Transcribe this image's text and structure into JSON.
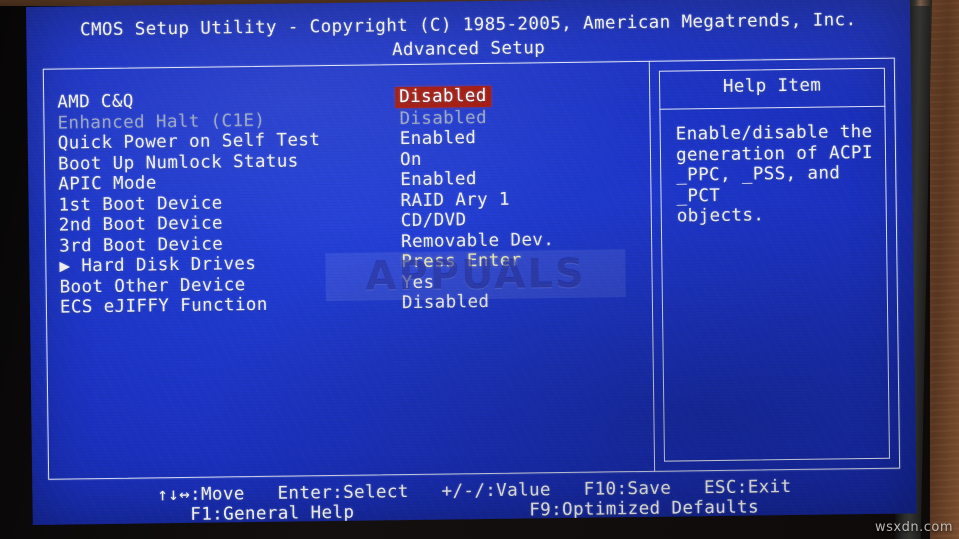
{
  "header": {
    "title": "CMOS Setup Utility - Copyright (C) 1985-2005, American Megatrends, Inc.",
    "subtitle": "Advanced Setup"
  },
  "settings": {
    "rows": [
      {
        "label": "AMD C&Q",
        "value": "Disabled",
        "state": "selected"
      },
      {
        "label": "Enhanced Halt (C1E)",
        "value": "Disabled",
        "state": "dimmed"
      },
      {
        "label": "Quick Power on Self Test",
        "value": "Enabled",
        "state": "normal"
      },
      {
        "label": "Boot Up Numlock Status",
        "value": "On",
        "state": "normal"
      },
      {
        "label": "APIC Mode",
        "value": "Enabled",
        "state": "normal"
      },
      {
        "label": "1st Boot Device",
        "value": "RAID Ary 1",
        "state": "normal"
      },
      {
        "label": "2nd Boot Device",
        "value": "CD/DVD",
        "state": "normal"
      },
      {
        "label": "3rd Boot Device",
        "value": "Removable Dev.",
        "state": "normal"
      },
      {
        "label": "Hard Disk Drives",
        "value": "Press Enter",
        "state": "submenu",
        "marker": "▶"
      },
      {
        "label": "Boot Other Device",
        "value": "Yes",
        "state": "normal"
      },
      {
        "label": "ECS eJIFFY Function",
        "value": "Disabled",
        "state": "normal"
      }
    ]
  },
  "help": {
    "title": "Help Item",
    "body": "Enable/disable the\ngeneration of ACPI\n_PPC, _PSS, and _PCT\nobjects."
  },
  "footer": {
    "line1": "↑↓↔:Move   Enter:Select   +/-/:Value   F10:Save   ESC:Exit",
    "line2": "F1:General Help                F9:Optimized Defaults"
  },
  "watermarks": {
    "center": "APPUALS",
    "corner": "wsxdn.com"
  },
  "colors": {
    "screen_blue": "#1c33c4",
    "selection_red": "#a4170c",
    "text_white": "#f2f2f2",
    "text_dimmed": "#9aa6c4",
    "text_yellow": "#f2efb4",
    "bezel_dark": "#120f0d",
    "wall_brown": "#6a4026"
  }
}
